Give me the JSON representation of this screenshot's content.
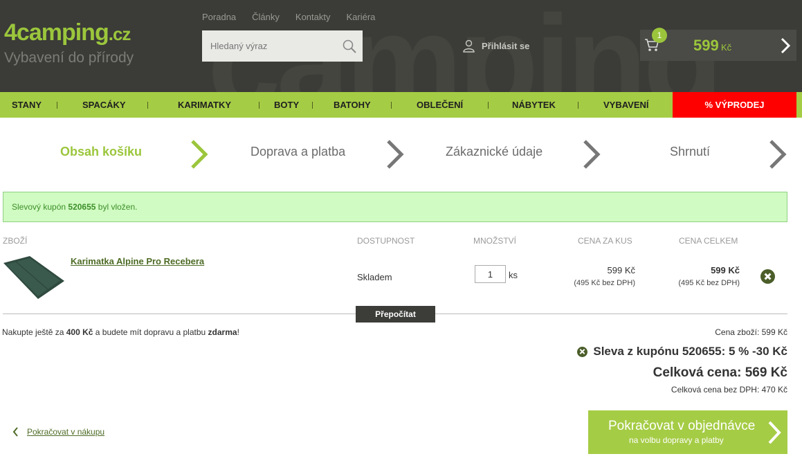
{
  "header": {
    "logo_main": "4camping",
    "logo_tld": ".cz",
    "logo_sub": "Vybavení do přírody",
    "top_links": [
      "Poradna",
      "Články",
      "Kontakty",
      "Kariéra"
    ],
    "search_placeholder": "Hledaný výraz",
    "login_label": "Přihlásit se",
    "cart_count": "1",
    "cart_price": "599",
    "cart_currency": "Kč"
  },
  "nav": {
    "items": [
      "STANY",
      "SPACÁKY",
      "KARIMATKY",
      "BOTY",
      "BATOHY",
      "OBLEČENÍ",
      "NÁBYTEK",
      "VYBAVENÍ"
    ],
    "sale_label": "% VÝPRODEJ"
  },
  "steps": [
    "Obsah košíku",
    "Doprava a platba",
    "Zákaznické údaje",
    "Shrnutí"
  ],
  "alert": {
    "prefix": "Slevový kupón ",
    "code": "520655",
    "suffix": " byl vložen."
  },
  "table": {
    "headers": [
      "ZBOŽÍ",
      "DOSTUPNOST",
      "MNOŽSTVÍ",
      "CENA ZA KUS",
      "CENA CELKEM"
    ],
    "rows": [
      {
        "name": "Karimatka Alpine Pro Recebera",
        "availability": "Skladem",
        "quantity": "1",
        "unit": "ks",
        "unit_price": "599 Kč",
        "unit_price_no_vat": "(495 Kč bez DPH)",
        "total_price": "599 Kč",
        "total_price_no_vat": "(495 Kč bez DPH)"
      }
    ],
    "recalc_label": "Přepočítat"
  },
  "summary": {
    "free_prefix": "Nakupte ještě za ",
    "free_amount": "400 Kč",
    "free_middle": " a budete mít dopravu a platbu ",
    "free_word": "zdarma",
    "free_end": "!",
    "goods_price": "Cena zboží: 599 Kč",
    "coupon": "Sleva z kupónu 520655: 5 % -30 Kč",
    "total": "Celková cena: 569 Kč",
    "total_no_vat": "Celková cena bez DPH: 470 Kč"
  },
  "actions": {
    "continue_shopping": "Pokračovat v nákupu",
    "checkout_main": "Pokračovat v objednávce",
    "checkout_sub": "na volbu dopravy a platby"
  },
  "colors": {
    "accent_green": "#a5cc45",
    "header_dark": "#3b3b38",
    "sale_red": "#ff0000"
  }
}
